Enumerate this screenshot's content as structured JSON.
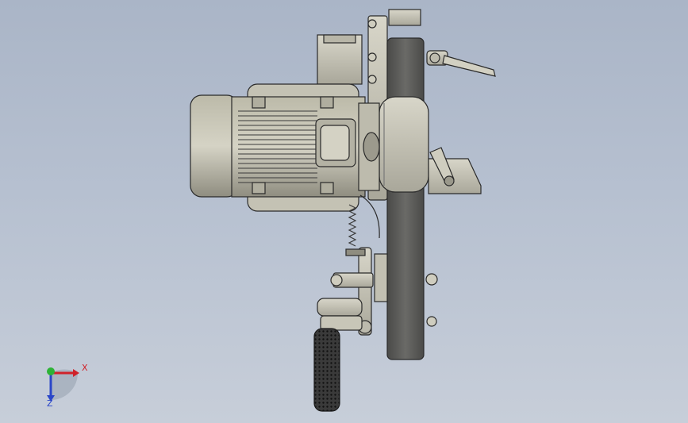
{
  "triad": {
    "x_label": "X",
    "z_label": "Z"
  },
  "colors": {
    "background": "#b3bdcd",
    "part": "#c9c7b9",
    "part_dark": "#8f8d80",
    "belt": "#5c5c5a",
    "edge": "#2a2a2a",
    "x_axis": "#d0222a",
    "y_axis": "#2db336",
    "z_axis": "#2a46c8"
  }
}
